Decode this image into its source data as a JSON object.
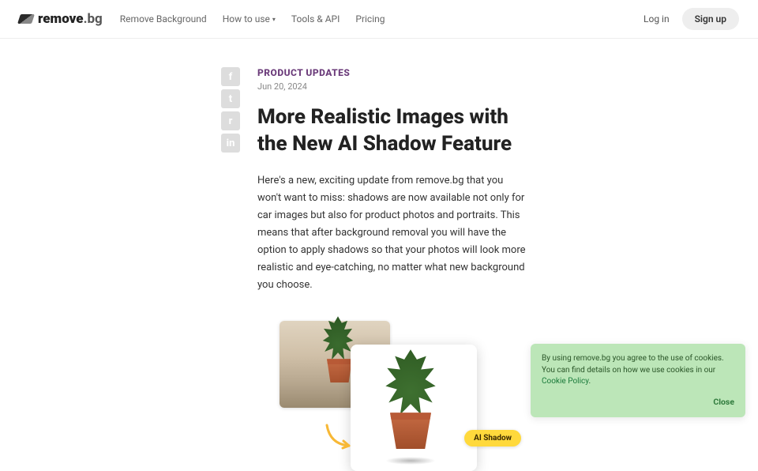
{
  "header": {
    "logo_bold": "remove",
    "logo_light": ".bg",
    "nav": {
      "remove_bg": "Remove Background",
      "how_to_use": "How to use",
      "tools_api": "Tools & API",
      "pricing": "Pricing"
    },
    "login": "Log in",
    "signup": "Sign up"
  },
  "social": {
    "facebook": "f",
    "twitter": "t",
    "reddit": "r",
    "linkedin": "in"
  },
  "article": {
    "category": "PRODUCT UPDATES",
    "date": "Jun 20, 2024",
    "title": "More Realistic Images with the New AI Shadow Feature",
    "body": "Here's a new, exciting update from remove.bg that you won't want to miss: shadows are now available not only for car images but also for product photos and portraits. This means that after background removal you will have the option to apply shadows so that your photos will look more realistic and eye-catching, no matter what new background you choose."
  },
  "illustration": {
    "badge": "AI Shadow"
  },
  "cookie": {
    "text_before": "By using remove.bg you agree to the use of cookies. You can find details on how we use cookies in our ",
    "link": "Cookie Policy",
    "text_after": ".",
    "close": "Close"
  }
}
